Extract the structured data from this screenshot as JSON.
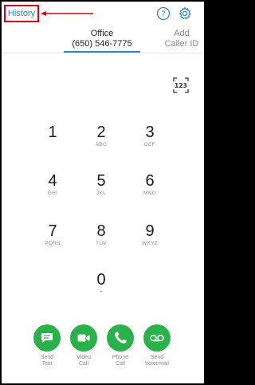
{
  "top_bar": {
    "history_label": "History"
  },
  "caller_id": {
    "office_label": "Office",
    "office_number": "(650) 546-7775",
    "add_line1": "Add",
    "add_line2": "Caller ID"
  },
  "keypad": {
    "toggle_icon": "keypad-123-icon",
    "keys": [
      {
        "digit": "1",
        "letters": ""
      },
      {
        "digit": "2",
        "letters": "ABC"
      },
      {
        "digit": "3",
        "letters": "DEF"
      },
      {
        "digit": "4",
        "letters": "GHI"
      },
      {
        "digit": "5",
        "letters": "JKL"
      },
      {
        "digit": "6",
        "letters": "MNO"
      },
      {
        "digit": "7",
        "letters": "PQRS"
      },
      {
        "digit": "8",
        "letters": "TUV"
      },
      {
        "digit": "9",
        "letters": "WXYZ"
      },
      {
        "digit": "0",
        "letters": "+"
      }
    ]
  },
  "actions": [
    {
      "line1": "Send",
      "line2": "Text",
      "icon": "message-icon"
    },
    {
      "line1": "Video",
      "line2": "Call",
      "icon": "video-icon"
    },
    {
      "line1": "Phone",
      "line2": "Call",
      "icon": "phone-icon"
    },
    {
      "line1": "Send",
      "line2": "Voicemail",
      "icon": "voicemail-icon"
    }
  ],
  "colors": {
    "accent_blue": "#2f86c9",
    "action_green": "#2ab24a",
    "annotation_red": "#d0021b"
  }
}
